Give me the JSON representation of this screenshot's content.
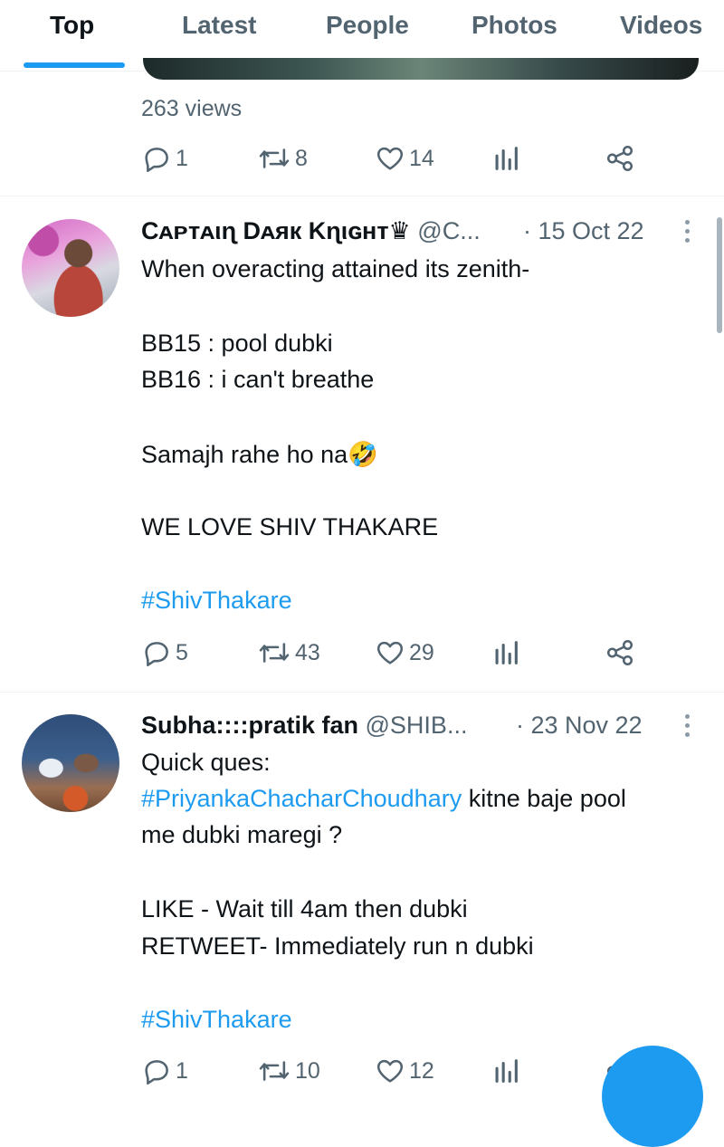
{
  "tabs": [
    "Top",
    "Latest",
    "People",
    "Photos",
    "Videos"
  ],
  "prev_tweet": {
    "views": "263 views",
    "replies": "1",
    "retweets": "8",
    "likes": "14"
  },
  "tweets": [
    {
      "name": "Cᴀᴘᴛᴀιɳ Dᴀяк Kɳιɢʜᴛ♛",
      "handle": "@C...",
      "date": "· 15 Oct 22",
      "lines": [
        "When overacting attained its zenith-",
        "BB15 : pool dubki",
        "BB16 : i can't breathe",
        "Samajh rahe ho na🤣",
        "WE LOVE SHIV THAKARE",
        "#ShivThakare"
      ],
      "replies": "5",
      "retweets": "43",
      "likes": "29"
    },
    {
      "name": "Subha::::pratik fan",
      "handle": "@SHIB...",
      "date": "· 23 Nov 22",
      "lines": [
        "Quick ques:",
        "#PriyankaChacharChoudhary",
        " kitne baje pool",
        "me dubki maregi ?",
        "LIKE - Wait till 4am then dubki",
        "RETWEET- Immediately run n dubki",
        "#ShivThakare"
      ],
      "replies": "1",
      "retweets": "10",
      "likes": "12"
    }
  ],
  "icons": {
    "reply": "reply-icon",
    "retweet": "retweet-icon",
    "like": "heart-icon",
    "views": "analytics-icon",
    "share": "share-icon",
    "more": "more-vertical-icon"
  },
  "colors": {
    "accent": "#1d9bf0",
    "text": "#0f1419",
    "secondary": "#536471"
  }
}
